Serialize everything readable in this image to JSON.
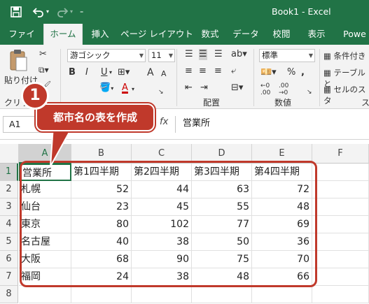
{
  "title_bar": {
    "doc_title": "Book1  -  Excel",
    "qat": {
      "save_icon": "save-icon",
      "undo_icon": "undo-icon",
      "redo_icon": "redo-icon",
      "customize_icon": "customize-qat-icon"
    }
  },
  "tabs": [
    "ファイル",
    "ホーム",
    "挿入",
    "ページ レイアウト",
    "数式",
    "データ",
    "校閲",
    "表示",
    "Powe"
  ],
  "active_tab": "ホーム",
  "ribbon": {
    "clipboard": {
      "paste_label": "貼り付け",
      "group_label": "クリップ"
    },
    "font": {
      "font_name": "游ゴシック",
      "font_size": "11",
      "bold": "B",
      "italic": "I",
      "underline": "U",
      "grow": "A",
      "shrink": "A"
    },
    "alignment": {
      "group_label": "配置"
    },
    "number": {
      "format": "標準",
      "percent": "%",
      "comma": ",",
      "group_label": "数値"
    },
    "styles": {
      "conditional": "条件付き",
      "table": "テーブルと",
      "cell_styles": "セルのスタ",
      "group_label": "ス"
    }
  },
  "formula_bar": {
    "name_box": "A1",
    "fx": "fx",
    "value": "営業所"
  },
  "columns": [
    "A",
    "B",
    "C",
    "D",
    "E",
    "F"
  ],
  "rows": [
    "1",
    "2",
    "3",
    "4",
    "5",
    "6",
    "7",
    "8"
  ],
  "table": {
    "header": [
      "営業所",
      "第1四半期",
      "第2四半期",
      "第3四半期",
      "第4四半期"
    ],
    "rows": [
      [
        "札幌",
        "52",
        "44",
        "63",
        "72"
      ],
      [
        "仙台",
        "23",
        "45",
        "55",
        "48"
      ],
      [
        "東京",
        "80",
        "102",
        "77",
        "69"
      ],
      [
        "名古屋",
        "40",
        "38",
        "50",
        "36"
      ],
      [
        "大阪",
        "68",
        "90",
        "75",
        "70"
      ],
      [
        "福岡",
        "24",
        "38",
        "48",
        "66"
      ]
    ]
  },
  "annotation": {
    "badge": "1",
    "text": "都市名の表を作成",
    "color": "#c0392b"
  },
  "colors": {
    "excel_green": "#217346"
  }
}
